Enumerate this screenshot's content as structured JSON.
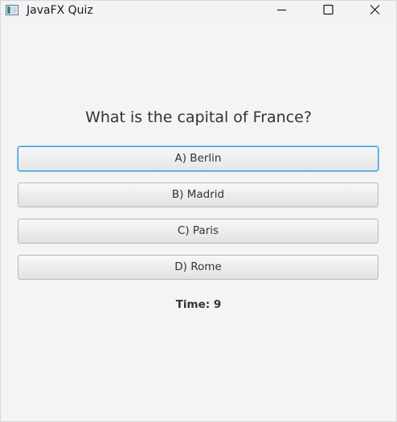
{
  "window": {
    "title": "JavaFX Quiz",
    "icons": {
      "app": "javafx-window-icon",
      "minimize": "minimize-icon",
      "maximize": "maximize-icon",
      "close": "close-icon"
    }
  },
  "quiz": {
    "question": "What is the capital of France?",
    "answers": [
      {
        "label": "A) Berlin",
        "focused": true
      },
      {
        "label": "B) Madrid",
        "focused": false
      },
      {
        "label": "C) Paris",
        "focused": false
      },
      {
        "label": "D) Rome",
        "focused": false
      }
    ],
    "timer_text": "Time: 9"
  },
  "colors": {
    "background": "#f4f4f4",
    "focus_ring": "#3c99d8",
    "text": "#333333"
  }
}
